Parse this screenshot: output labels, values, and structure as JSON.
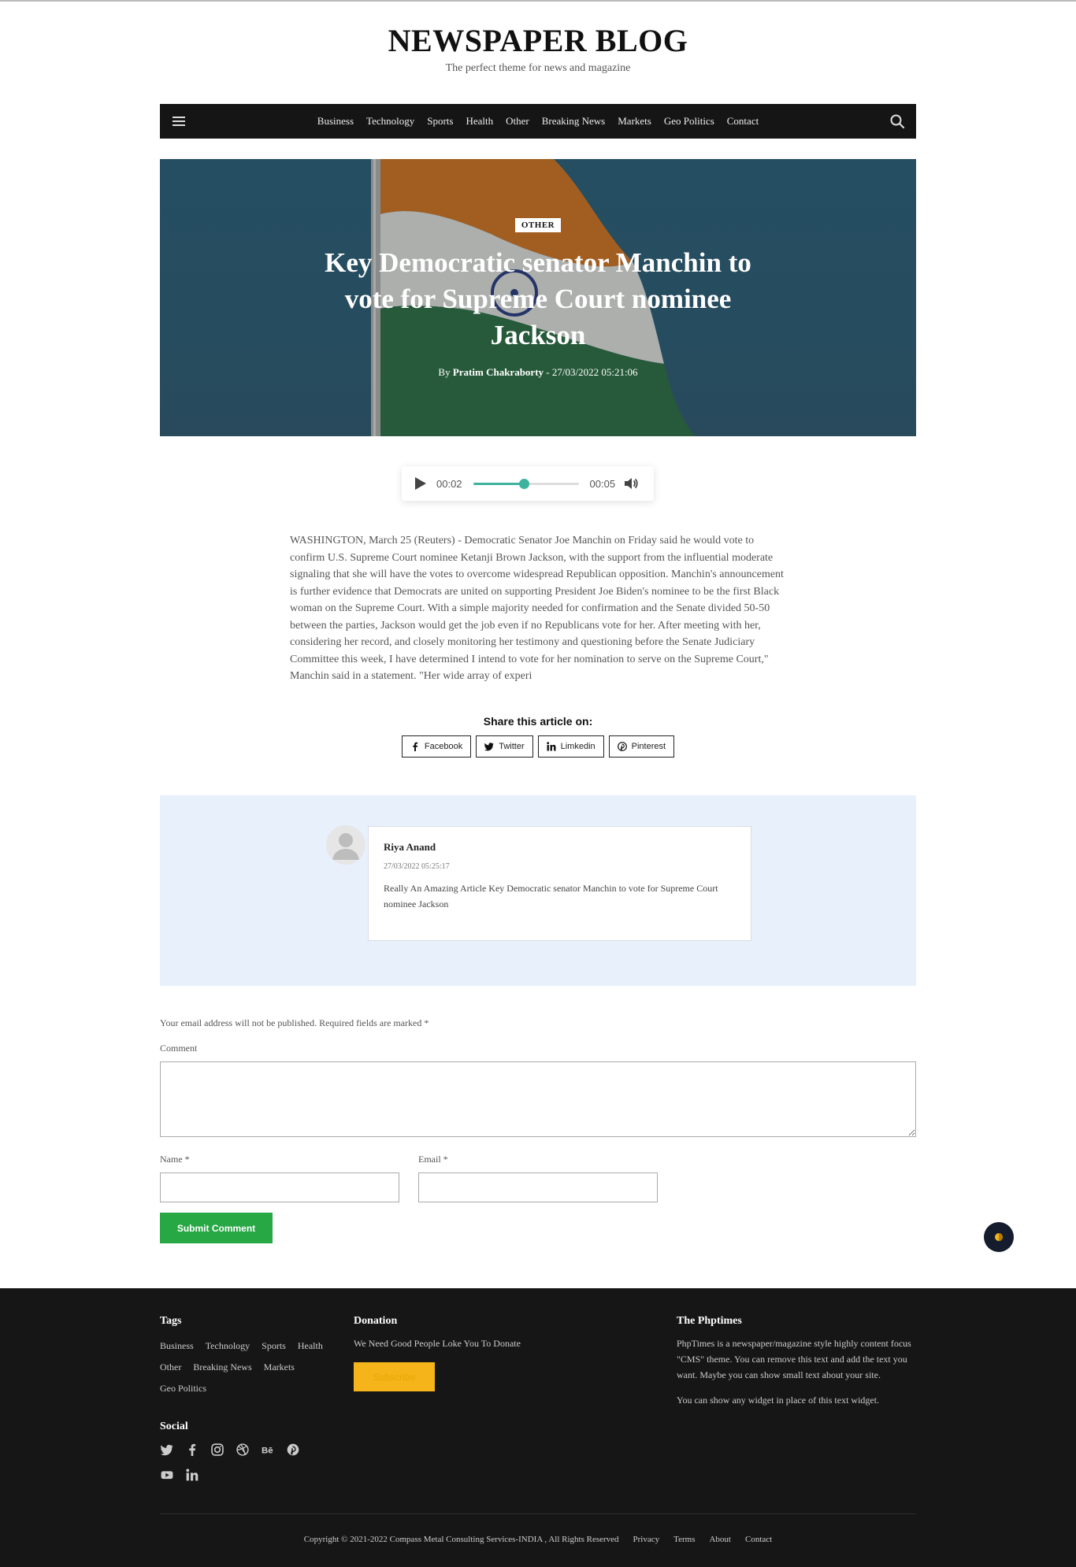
{
  "site": {
    "title": "NEWSPAPER BLOG",
    "tagline": "The perfect theme for news and magazine"
  },
  "nav": {
    "items": [
      "Business",
      "Technology",
      "Sports",
      "Health",
      "Other",
      "Breaking News",
      "Markets",
      "Geo Politics",
      "Contact"
    ],
    "menu_icon": "hamburger-icon",
    "search_icon": "search-icon"
  },
  "hero": {
    "category": "OTHER",
    "title": "Key Democratic senator Manchin to vote for Supreme Court nominee Jackson",
    "by_label": "By",
    "author": "Pratim Chakraborty",
    "date": "- 27/03/2022 05:21:06"
  },
  "audio": {
    "current_time": "00:02",
    "duration": "00:05",
    "progress": 0.48,
    "accent": "#3db39e"
  },
  "article": {
    "body": "WASHINGTON, March 25 (Reuters) - Democratic Senator Joe Manchin on Friday said he would vote to confirm U.S. Supreme Court nominee Ketanji Brown Jackson, with the support from the influential moderate signaling that she will have the votes to overcome widespread Republican opposition. Manchin's announcement is further evidence that Democrats are united on supporting President Joe Biden's nominee to be the first Black woman on the Supreme Court. With a simple majority needed for confirmation and the Senate divided 50-50 between the parties, Jackson would get the job even if no Republicans vote for her. After meeting with her, considering her record, and closely monitoring her testimony and questioning before the Senate Judiciary Committee this week, I have determined I intend to vote for her nomination to serve on the Supreme Court,\" Manchin said in a statement. \"Her wide array of experi"
  },
  "share": {
    "title": "Share this article on:",
    "buttons": [
      "Facebook",
      "Twitter",
      "Limkedin",
      "Pinterest"
    ]
  },
  "comments": [
    {
      "author": "Riya Anand",
      "date": "27/03/2022 05:25:17",
      "text": "Really An Amazing Article Key Democratic senator Manchin to vote for Supreme Court nominee Jackson"
    }
  ],
  "form": {
    "note": "Your email address will not be published. Required fields are marked *",
    "comment_label": "Comment",
    "name_label": "Name *",
    "email_label": "Email *",
    "submit_label": "Submit Comment"
  },
  "footer": {
    "tags_heading": "Tags",
    "tags": [
      "Business",
      "Technology",
      "Sports",
      "Health",
      "Other",
      "Breaking News",
      "Markets",
      "Geo Politics"
    ],
    "donation_heading": "Donation",
    "donation_text": "We Need Good People Loke You To Donate",
    "donation_button": "Subscribe",
    "about_heading": "The Phptimes",
    "about_text_1": "PhpTimes is a newspaper/magazine style highly content focus \"CMS\" theme. You can remove this text and add the text you want. Maybe you can show small text about your site.",
    "about_text_2": "You can show any widget in place of this text widget.",
    "social_heading": "Social",
    "social_icons": [
      "twitter-icon",
      "facebook-icon",
      "instagram-icon",
      "dribbble-icon",
      "behance-icon",
      "pinterest-icon",
      "youtube-icon",
      "linkedin-icon"
    ],
    "copyright": "Copyright © 2021-2022 Compass Metal Consulting Services-INDIA , All Rights Reserved",
    "links": [
      "Privacy",
      "Terms",
      "About",
      "Contact"
    ]
  }
}
